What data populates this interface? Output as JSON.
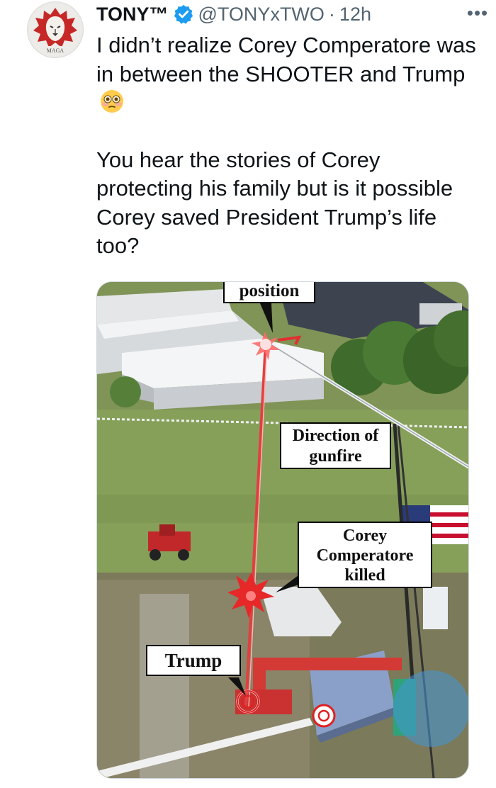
{
  "author": {
    "display_name": "TONY™",
    "handle": "@TONYxTWO",
    "separator": "·",
    "time_ago": "12h",
    "avatar_text": "MAGA",
    "verified": true,
    "verified_color": "#1d9bf0"
  },
  "tweet": {
    "paragraph_1": "I didn’t realize Corey Comperatore was in between the SHOOTER and Trump",
    "paragraph_1_emoji": "flushed-face",
    "paragraph_2": "You hear the stories of Corey protecting his family but is it possible Corey saved President Trump’s life too?"
  },
  "more_icon": "•••",
  "media": {
    "labels": {
      "position": "position",
      "direction": "Direction of gunfire",
      "corey": "Corey Comperatore killed",
      "trump": "Trump"
    }
  }
}
